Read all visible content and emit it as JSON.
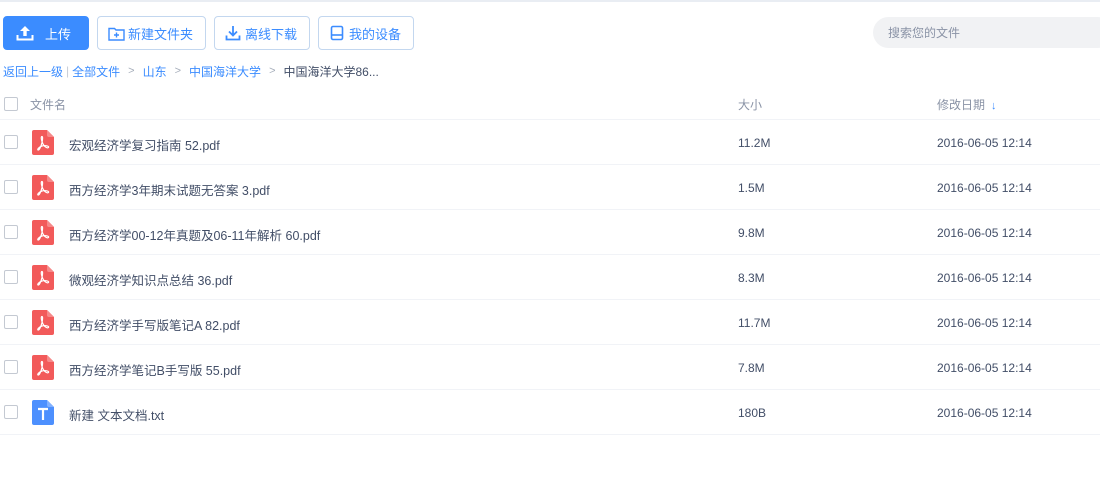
{
  "toolbar": {
    "upload": "上传",
    "new_folder": "新建文件夹",
    "offline_download": "离线下载",
    "my_devices": "我的设备"
  },
  "search": {
    "placeholder": "搜索您的文件"
  },
  "breadcrumb": {
    "back": "返回上一级",
    "items": [
      "全部文件",
      "山东",
      "中国海洋大学"
    ],
    "current": "中国海洋大学86..."
  },
  "table": {
    "headers": {
      "name": "文件名",
      "size": "大小",
      "date": "修改日期"
    },
    "rows": [
      {
        "name": "宏观经济学复习指南 52.pdf",
        "size": "11.2M",
        "date": "2016-06-05 12:14",
        "type": "pdf"
      },
      {
        "name": "西方经济学3年期末试题无答案 3.pdf",
        "size": "1.5M",
        "date": "2016-06-05 12:14",
        "type": "pdf"
      },
      {
        "name": "西方经济学00-12年真题及06-11年解析 60.pdf",
        "size": "9.8M",
        "date": "2016-06-05 12:14",
        "type": "pdf"
      },
      {
        "name": "微观经济学知识点总结 36.pdf",
        "size": "8.3M",
        "date": "2016-06-05 12:14",
        "type": "pdf"
      },
      {
        "name": "西方经济学手写版笔记A 82.pdf",
        "size": "11.7M",
        "date": "2016-06-05 12:14",
        "type": "pdf"
      },
      {
        "name": "西方经济学笔记B手写版 55.pdf",
        "size": "7.8M",
        "date": "2016-06-05 12:14",
        "type": "pdf"
      },
      {
        "name": "新建 文本文档.txt",
        "size": "180B",
        "date": "2016-06-05 12:14",
        "type": "txt"
      }
    ]
  },
  "colors": {
    "accent": "#3b8cff",
    "pdf": "#f25a5a",
    "txt": "#4d90fe"
  }
}
